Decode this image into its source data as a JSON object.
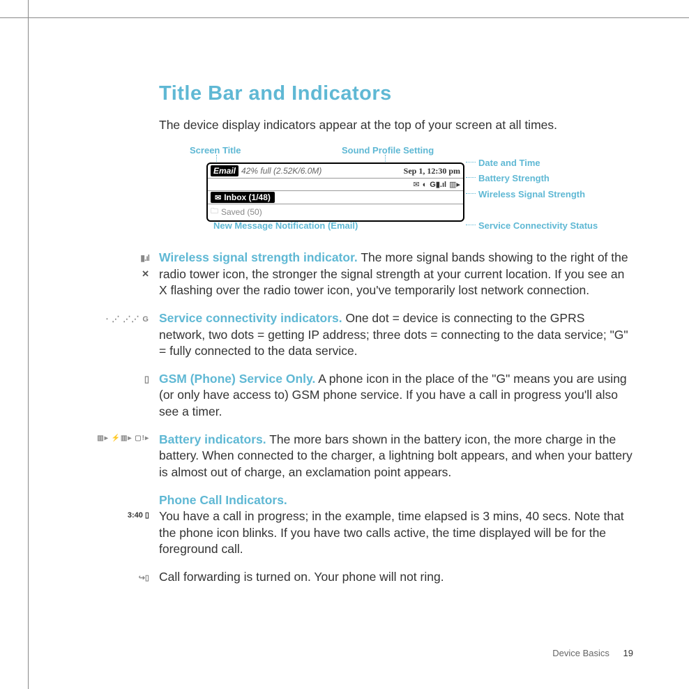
{
  "title": "Title Bar and Indicators",
  "intro": "The device display indicators appear at the top of your screen at all times.",
  "diagram": {
    "labels": {
      "screen_title": "Screen Title",
      "sound_profile": "Sound Profile Setting",
      "date_time": "Date and Time",
      "battery": "Battery Strength",
      "wireless": "Wireless Signal Strength",
      "service": "Service Connectivity Status",
      "new_msg": "New Message Notification (Email)"
    },
    "bar": {
      "email_tag": "Email",
      "full": "42% full (2.52K/6.0M)",
      "date": "Sep 1, 12:30 pm",
      "inbox": "Inbox (1/48)",
      "saved": "Saved (50)"
    }
  },
  "items": [
    {
      "icon_type": "signal",
      "lead": "Wireless signal strength indicator.",
      "text": " The more signal bands showing to the right of the radio tower icon, the stronger the signal strength at your current location. If you see an X flashing over the radio tower icon, you've temporarily lost network connection."
    },
    {
      "icon_type": "connectivity",
      "lead": "Service connectivity indicators.",
      "text": " One dot = device is connecting to the GPRS network, two dots = getting IP address; three dots = connecting to the data service; \"G\" = fully connected to the data service."
    },
    {
      "icon_type": "phone",
      "lead": "GSM (Phone) Service Only.",
      "text": "  A phone icon in the place of the \"G\" means you are using (or only have access to) GSM phone service. If you have a call in progress you'll also see a timer."
    },
    {
      "icon_type": "battery",
      "lead": "Battery indicators.",
      "text": " The more bars shown in the battery icon, the more charge in the battery. When connected to the charger, a lightning bolt appears, and when your battery is almost out of charge, an exclamation point appears."
    },
    {
      "icon_type": "call",
      "icon_text": "3:40 ▯",
      "lead": "Phone Call Indicators.",
      "text": "You have a call in progress; in the example, time elapsed is 3 mins, 40 secs. Note that the phone icon blinks. If you have two calls active, the time displayed will be for the foreground call."
    },
    {
      "icon_type": "forward",
      "lead": "",
      "text": "Call forwarding is turned on. Your phone will not ring."
    }
  ],
  "battery_icons": "▥▸  ⚡▥▸  ▢!▸",
  "footer": {
    "section": "Device Basics",
    "page": "19"
  }
}
